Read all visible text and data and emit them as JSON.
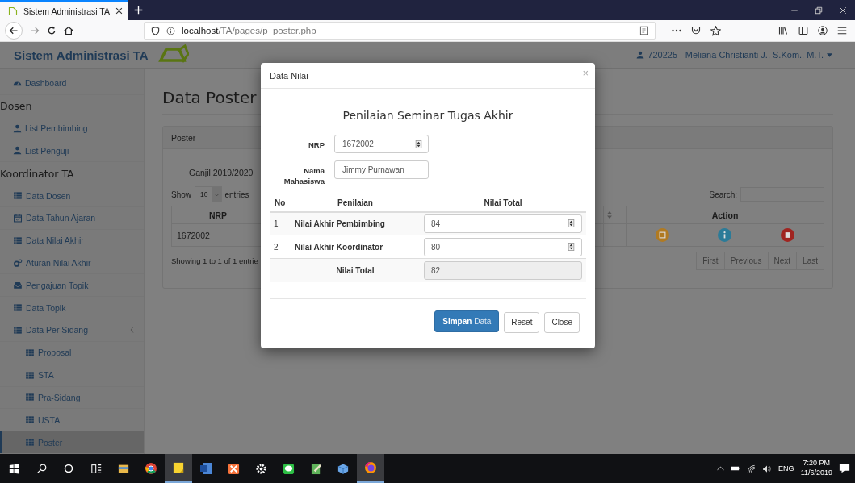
{
  "browser": {
    "tab_title": "Sistem Administrasi TA",
    "url_host": "localhost",
    "url_path": "/TA/pages/p_poster.php"
  },
  "navbar": {
    "brand": "Sistem Administrasi TA",
    "user": "720225 - Meliana Christianti J., S.Kom., M.T."
  },
  "sidebar": [
    {
      "kind": "dashboard",
      "label": "Dashboard",
      "selected": false
    },
    {
      "kind": "heading",
      "label": "Dosen"
    },
    {
      "kind": "user",
      "label": "List Pembimbing",
      "selected": false
    },
    {
      "kind": "user",
      "label": "List Penguji",
      "selected": false
    },
    {
      "kind": "heading",
      "label": "Koordinator TA"
    },
    {
      "kind": "list",
      "label": "Data Dosen",
      "selected": false
    },
    {
      "kind": "calendar",
      "label": "Data Tahun Ajaran",
      "selected": false
    },
    {
      "kind": "list",
      "label": "Data Nilai Akhir",
      "selected": false
    },
    {
      "kind": "gears",
      "label": "Aturan Nilai Akhir",
      "selected": false
    },
    {
      "kind": "inbox",
      "label": "Pengajuan Topik",
      "selected": false
    },
    {
      "kind": "list",
      "label": "Data Topik",
      "selected": false
    },
    {
      "kind": "list",
      "label": "Data Per Sidang",
      "selected": false,
      "expanded": true,
      "children": [
        {
          "kind": "grid",
          "label": "Proposal",
          "selected": false
        },
        {
          "kind": "grid",
          "label": "STA",
          "selected": false
        },
        {
          "kind": "grid",
          "label": "Pra-Sidang",
          "selected": false
        },
        {
          "kind": "grid",
          "label": "USTA",
          "selected": false
        },
        {
          "kind": "grid",
          "label": "Poster",
          "selected": true
        }
      ]
    }
  ],
  "main": {
    "page_title": "Data Poster",
    "panel_title": "Poster",
    "semester": "Ganjil 2019/2020",
    "show_label": "Show",
    "page_length": "10",
    "entries_label": "entries",
    "search_label": "Search:",
    "columns": [
      "NRP",
      "Action"
    ],
    "rows": [
      {
        "nrp": "1672002",
        "actions": [
          {
            "kind": "edit",
            "color": "#b07a22"
          },
          {
            "kind": "info",
            "color": "#2b7b98"
          },
          {
            "kind": "delete",
            "color": "#a02420"
          }
        ]
      }
    ],
    "info": "Showing 1 to 1 of 1 entrie",
    "pagination": [
      "First",
      "Previous",
      "Next",
      "Last"
    ]
  },
  "modal": {
    "title": "Data Nilai",
    "close": "×",
    "heading": "Penilaian Seminar Tugas Akhir",
    "fields": [
      {
        "label": "NRP",
        "value": "1672002",
        "kind": "number"
      },
      {
        "label": "Nama Mahasiswa",
        "value": "Jimmy Purnawan",
        "kind": "text"
      }
    ],
    "columns": [
      "No",
      "Penilaian",
      "Nilai Total"
    ],
    "rows": [
      {
        "no": "1",
        "label": "Nilai Akhir Pembimbing",
        "value": "84"
      },
      {
        "no": "2",
        "label": "Nilai Akhir Koordinator",
        "value": "80"
      }
    ],
    "total": {
      "label": "Nilai Total",
      "value": "82"
    },
    "buttons": [
      {
        "label": "**Simpan** Data",
        "kind": "primary"
      },
      {
        "label": "Reset",
        "kind": "default"
      },
      {
        "label": "Close",
        "kind": "default"
      }
    ]
  },
  "taskbar": {
    "apps": [
      {
        "kind": "explorer",
        "active": false
      },
      {
        "kind": "chrome",
        "active": false
      },
      {
        "kind": "notes",
        "active": true
      },
      {
        "kind": "word",
        "active": false
      },
      {
        "kind": "xampp",
        "active": false
      },
      {
        "kind": "settings",
        "active": false
      },
      {
        "kind": "chat",
        "active": false
      },
      {
        "kind": "editor",
        "active": false
      },
      {
        "kind": "box",
        "active": false
      },
      {
        "kind": "firefox",
        "active": true
      }
    ],
    "language": "ENG",
    "time": "7:20 PM",
    "date": "11/6/2019"
  }
}
